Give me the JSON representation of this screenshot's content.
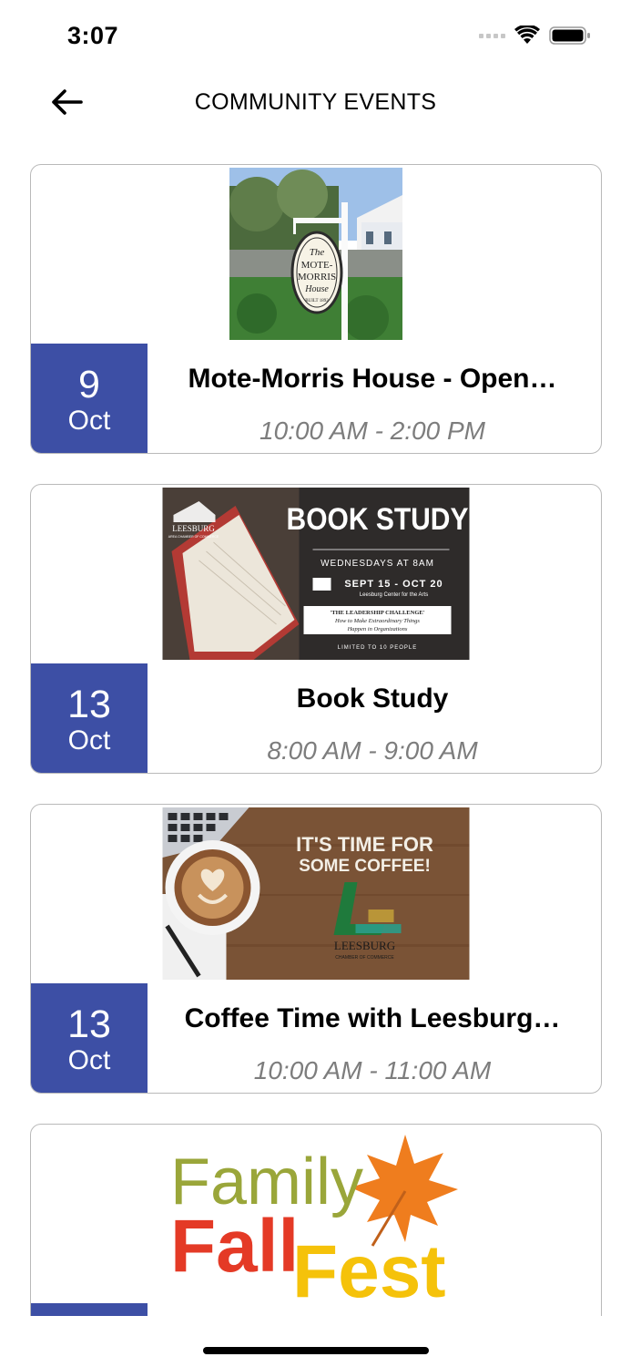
{
  "status_bar": {
    "time": "3:07",
    "icons": [
      "cellular-signal-icon",
      "wifi-icon",
      "battery-icon"
    ]
  },
  "nav": {
    "back_icon": "arrow-left-icon",
    "title": "COMMUNITY EVENTS"
  },
  "colors": {
    "date_badge": "#3d4fa5",
    "time_text": "#7d7d7d",
    "card_border": "#b9b9b9"
  },
  "events": [
    {
      "day": "9",
      "month": "Oct",
      "title": "Mote-Morris House - Open…",
      "time": "10:00 AM - 2:00 PM",
      "image": {
        "sign_lines": [
          "The",
          "MOTE-",
          "MORRIS",
          "House",
          "BUILT 1892"
        ]
      }
    },
    {
      "day": "13",
      "month": "Oct",
      "title": "Book Study",
      "time": "8:00 AM - 9:00 AM",
      "image": {
        "logo_text": "LEESBURG",
        "logo_sub": "AREA CHAMBER OF COMMERCE",
        "headline": "BOOK STUDY",
        "schedule": "WEDNESDAYS AT 8AM",
        "dates": "SEPT 15 - OCT 20",
        "venue": "Leesburg Center for the Arts",
        "book_title": "'THE LEADERSHIP CHALLENGE'",
        "book_sub1": "How to Make Extraordinary Things",
        "book_sub2": "Happen in Organizations",
        "limit": "LIMITED TO 10 PEOPLE"
      }
    },
    {
      "day": "13",
      "month": "Oct",
      "title": "Coffee Time with Leesburg…",
      "time": "10:00 AM - 11:00 AM",
      "image": {
        "line1": "IT'S TIME FOR",
        "line2": "SOME COFFEE!",
        "logo_text": "LEESBURG",
        "logo_sub": "CHAMBER OF COMMERCE"
      }
    },
    {
      "day": "",
      "month": "",
      "title": "",
      "time": "",
      "image": {
        "word1": "Family",
        "word2": "Fall",
        "word3": "Fest"
      }
    }
  ]
}
